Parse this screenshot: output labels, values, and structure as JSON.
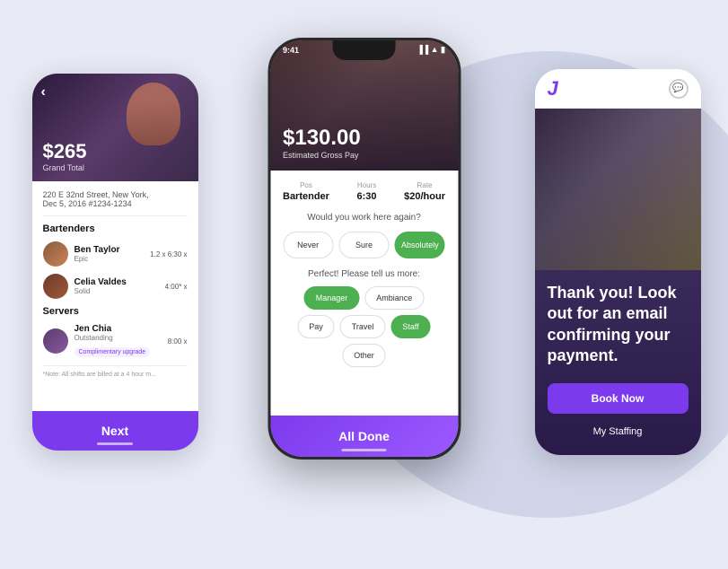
{
  "background": {
    "color": "#e8eaf6"
  },
  "left_phone": {
    "amount": "$265",
    "grand_total_label": "Grand Total",
    "address": "220 E 32nd Street, New York,",
    "date": "Dec 5, 2016  #1234-1234",
    "sections": {
      "bartenders_label": "Bartenders",
      "servers_label": "Servers"
    },
    "staff": [
      {
        "name": "Ben Taylor",
        "role": "Epic",
        "hours": "1.2 x 6:30 x",
        "avatar": "ben"
      },
      {
        "name": "Celia Valdes",
        "role": "Solid",
        "hours": "4:00* x",
        "avatar": "celia"
      }
    ],
    "servers": [
      {
        "name": "Jen Chia",
        "role": "Outstanding",
        "hours": "8:00 x",
        "upgrade": "Complimentary upgrade",
        "avatar": "jen"
      }
    ],
    "note": "*Note: All shifts are billed at a 4 hour m...",
    "next_button": "Next"
  },
  "center_phone": {
    "status_time": "9:41",
    "pay_amount": "$130.00",
    "pay_label": "Estimated Gross Pay",
    "stats": {
      "pos_label": "Pos",
      "pos_value": "Bartender",
      "hours_label": "Hours",
      "hours_value": "6:30",
      "rate_label": "Rate",
      "rate_value": "$20/hour"
    },
    "question": "Would you work here again?",
    "ratings": [
      {
        "label": "Never",
        "active": false
      },
      {
        "label": "Sure",
        "active": false
      },
      {
        "label": "Absolutely",
        "active": true
      }
    ],
    "more_label": "Perfect! Please tell us more:",
    "tags": [
      {
        "label": "Manager",
        "active": true
      },
      {
        "label": "Ambiance",
        "active": false
      },
      {
        "label": "Pay",
        "active": false
      },
      {
        "label": "Travel",
        "active": false
      },
      {
        "label": "Staff",
        "active": true
      },
      {
        "label": "Other",
        "active": false
      }
    ],
    "all_done_button": "All Done"
  },
  "right_phone": {
    "logo": "J",
    "thank_you_text": "Thank you! Look out for an email confirming your payment.",
    "book_now_button": "Book Now",
    "my_staffing_button": "My Staffing"
  }
}
